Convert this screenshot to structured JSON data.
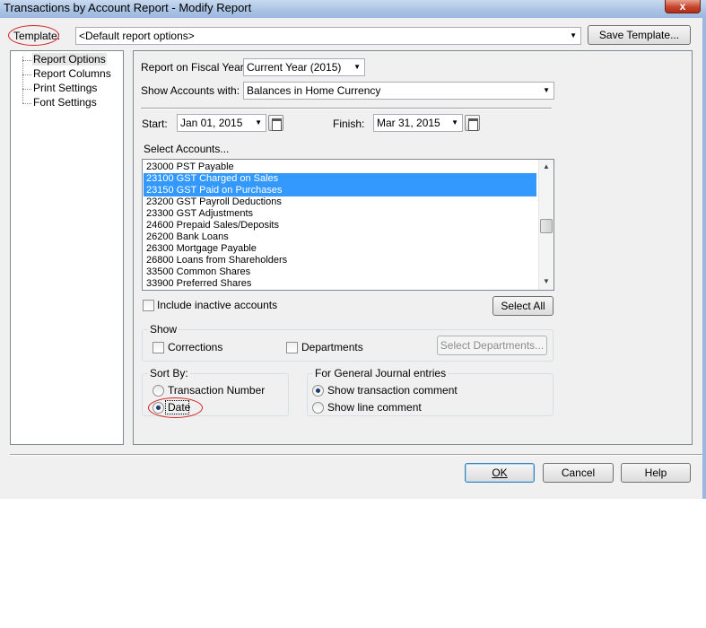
{
  "window": {
    "title": "Transactions by Account Report - Modify Report",
    "close_label": "x"
  },
  "template": {
    "label": "Template:",
    "value": "<Default report options>",
    "save_button": "Save Template..."
  },
  "tree": {
    "items": [
      {
        "label": "Report Options",
        "selected": true
      },
      {
        "label": "Report Columns"
      },
      {
        "label": "Print Settings"
      },
      {
        "label": "Font Settings"
      }
    ]
  },
  "options": {
    "fiscal_year_label": "Report on Fiscal Year:",
    "fiscal_year_value": "Current Year (2015)",
    "show_accounts_label": "Show Accounts with:",
    "show_accounts_value": "Balances in Home Currency",
    "start_label": "Start:",
    "start_value": "Jan 01, 2015",
    "finish_label": "Finish:",
    "finish_value": "Mar 31, 2015",
    "select_accounts_label": "Select Accounts...",
    "accounts": [
      {
        "label": "23000 PST Payable",
        "selected": false
      },
      {
        "label": "23100 GST Charged on Sales",
        "selected": true
      },
      {
        "label": "23150 GST Paid on Purchases",
        "selected": true
      },
      {
        "label": "23200 GST Payroll Deductions",
        "selected": false
      },
      {
        "label": "23300 GST Adjustments",
        "selected": false
      },
      {
        "label": "24600 Prepaid Sales/Deposits",
        "selected": false
      },
      {
        "label": "26200 Bank Loans",
        "selected": false
      },
      {
        "label": "26300 Mortgage Payable",
        "selected": false
      },
      {
        "label": "26800 Loans from Shareholders",
        "selected": false
      },
      {
        "label": "33500 Common Shares",
        "selected": false
      },
      {
        "label": "33900 Preferred Shares",
        "selected": false
      }
    ],
    "include_inactive_label": "Include inactive accounts",
    "select_all_button": "Select All",
    "show_group_title": "Show",
    "corrections_label": "Corrections",
    "departments_label": "Departments",
    "select_departments_button": "Select Departments...",
    "sort_by_title": "Sort By:",
    "sort_options": [
      {
        "label": "Transaction Number",
        "checked": false
      },
      {
        "label": "Date",
        "checked": true
      }
    ],
    "gj_title": "For General Journal entries",
    "gj_options": [
      {
        "label": "Show transaction comment",
        "checked": true
      },
      {
        "label": "Show line comment",
        "checked": false
      }
    ]
  },
  "footer": {
    "ok": "OK",
    "cancel": "Cancel",
    "help": "Help"
  },
  "colors": {
    "selection": "#3399ff",
    "annotation": "#d42020",
    "titlebar": "#a9c2e4"
  }
}
